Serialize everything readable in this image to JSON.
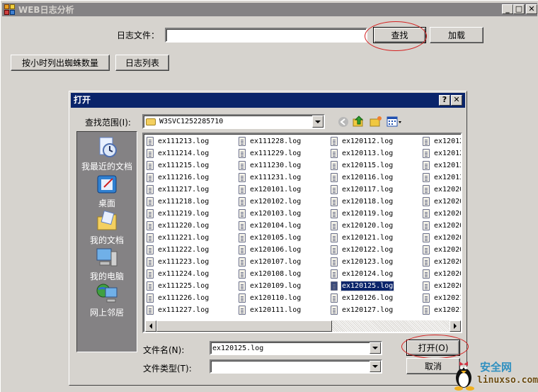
{
  "main_window": {
    "title": "WEB日志分析",
    "caption_buttons": {
      "minimize": "_",
      "maximize": "□",
      "close": "✕"
    },
    "log_file_label": "日志文件：",
    "log_file_value": "",
    "find_button": "查找",
    "load_button": "加载",
    "spider_by_hour_button": "按小时列出蜘蛛数量",
    "log_list_button": "日志列表"
  },
  "open_dialog": {
    "title": "打开",
    "help_button": "?",
    "close_button": "✕",
    "look_in_label": "查找范围(I):",
    "look_in_value": "W3SVC1252285710",
    "toolbar_icons": [
      "back-icon",
      "up-folder-icon",
      "new-folder-icon",
      "view-menu-icon"
    ],
    "places": [
      {
        "label": "我最近的文档",
        "icon": "recent-documents-icon"
      },
      {
        "label": "桌面",
        "icon": "desktop-icon"
      },
      {
        "label": "我的文档",
        "icon": "my-documents-icon"
      },
      {
        "label": "我的电脑",
        "icon": "my-computer-icon"
      },
      {
        "label": "网上邻居",
        "icon": "network-places-icon"
      }
    ],
    "file_columns": [
      [
        "ex111213.log",
        "ex111214.log",
        "ex111215.log",
        "ex111216.log",
        "ex111217.log",
        "ex111218.log",
        "ex111219.log",
        "ex111220.log",
        "ex111221.log",
        "ex111222.log",
        "ex111223.log",
        "ex111224.log",
        "ex111225.log",
        "ex111226.log",
        "ex111227.log"
      ],
      [
        "ex111228.log",
        "ex111229.log",
        "ex111230.log",
        "ex111231.log",
        "ex120101.log",
        "ex120102.log",
        "ex120103.log",
        "ex120104.log",
        "ex120105.log",
        "ex120106.log",
        "ex120107.log",
        "ex120108.log",
        "ex120109.log",
        "ex120110.log",
        "ex120111.log"
      ],
      [
        "ex120112.log",
        "ex120113.log",
        "ex120115.log",
        "ex120116.log",
        "ex120117.log",
        "ex120118.log",
        "ex120119.log",
        "ex120120.log",
        "ex120121.log",
        "ex120122.log",
        "ex120123.log",
        "ex120124.log",
        "ex120125.log",
        "ex120126.log",
        "ex120127.log"
      ],
      [
        "ex12012",
        "ex12012",
        "ex12013",
        "ex12013",
        "ex12020",
        "ex12020",
        "ex12020",
        "ex12020",
        "ex12020",
        "ex12020",
        "ex12020",
        "ex12020",
        "ex12020",
        "ex12021",
        "ex12021"
      ]
    ],
    "selected_file": "ex120125.log",
    "horizontal_scroll_position": 0.0,
    "file_name_label": "文件名(N):",
    "file_name_value": "ex120125.log",
    "file_type_label": "文件类型(T):",
    "file_type_value": "",
    "open_button": "打开(O)",
    "cancel_button": "取消"
  },
  "watermark": {
    "text_cn": "安全网",
    "text_url": "linuxso.com"
  },
  "colors": {
    "window_bg": "#d6d3ce",
    "inactive_titlebar": "#848284",
    "active_titlebar": "#0a246a",
    "selection": "#0a246a",
    "annotation_red": "#d42020"
  }
}
